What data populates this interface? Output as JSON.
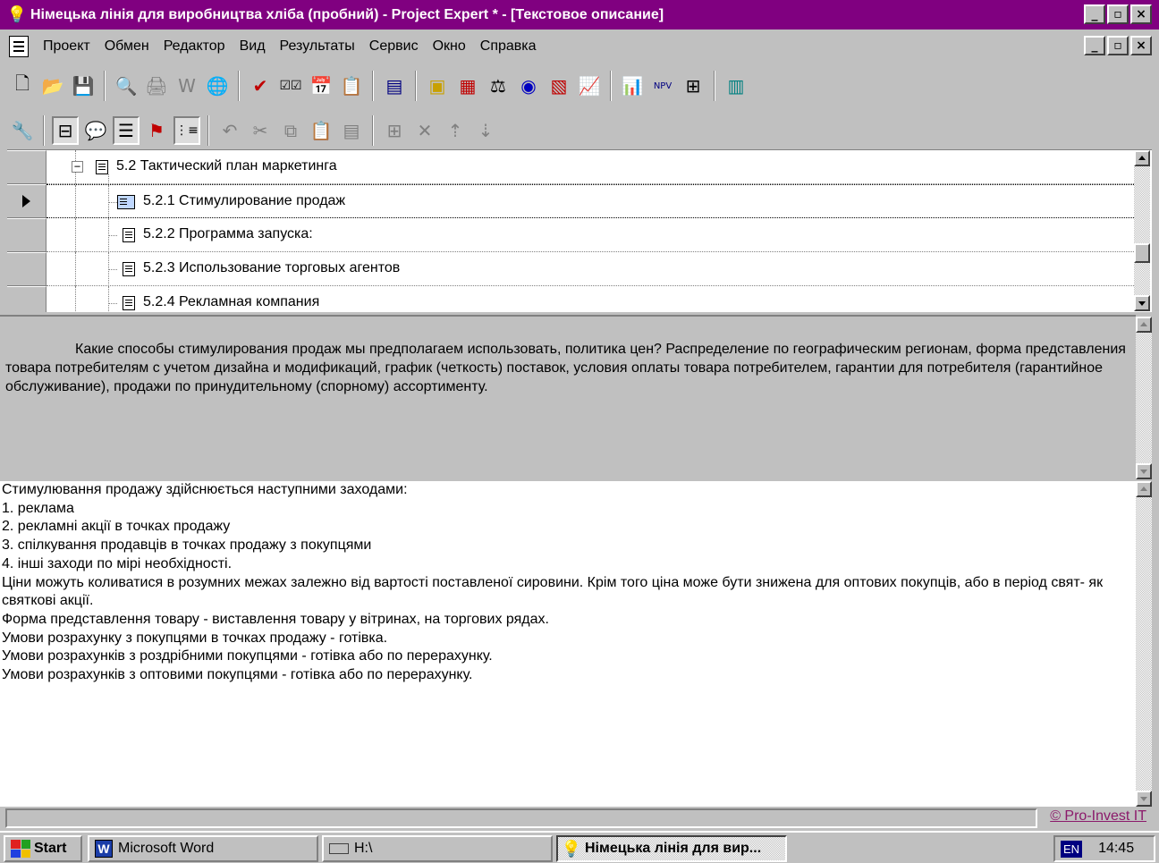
{
  "window": {
    "title": "Німецька лінія для виробництва хліба (пробний) - Project Expert * - [Текстовое описание]",
    "controls": {
      "minimize": "_",
      "restore": "▫",
      "close": "×"
    }
  },
  "menu": {
    "items": [
      "Проект",
      "Обмен",
      "Редактор",
      "Вид",
      "Результаты",
      "Сервис",
      "Окно",
      "Справка"
    ]
  },
  "toolbar1": {
    "icons": [
      "new-document-icon",
      "open-folder-icon",
      "save-disk-icon",
      "print-preview-icon",
      "print-icon",
      "word-export-icon",
      "globe-icon",
      "check-icon",
      "checklist-icon",
      "calendar-link-icon",
      "clipboard-icon",
      "window-icon",
      "table-icon",
      "chart-cf-icon",
      "balance-scale-icon",
      "analysis-icon",
      "report-icon",
      "graph-icon",
      "bar-chart-icon",
      "npv-icon",
      "network-icon",
      "calculator-icon"
    ]
  },
  "toolbar2": {
    "icons": [
      "wrench-icon",
      "tree-view-icon",
      "comment-icon",
      "list-view-icon",
      "stamp-icon",
      "numbering-icon",
      "undo-icon",
      "cut-icon",
      "copy-icon",
      "paste-icon",
      "format-icon",
      "move-node-icon",
      "delete-icon",
      "move-up-icon",
      "move-down-icon"
    ]
  },
  "tree": {
    "rows": [
      {
        "label": "5.2  Тактический план маркетинга",
        "level": 1,
        "expander": "−",
        "selected": false
      },
      {
        "label": "5.2.1 Стимулирование продаж",
        "level": 2,
        "selected": true
      },
      {
        "label": "5.2.2 Программа запуска:",
        "level": 2,
        "selected": false
      },
      {
        "label": "5.2.3 Использование торговых агентов",
        "level": 2,
        "selected": false
      },
      {
        "label": "5.2.4 Рекламная компания",
        "level": 2,
        "selected": false
      }
    ]
  },
  "description": {
    "text": "Какие способы стимулирования продаж мы предполагаем использовать, политика цен? Распределение по географическим регионам, форма представления товара потребителям с учетом дизайна и модификаций, график (четкость) поставок, условия оплаты товара потребителем, гарантии для потребителя (гарантийное обслуживание), продажи по принудительному (спорному) ассортименту."
  },
  "editor": {
    "lines": [
      "Стимулювання продажу здійснюється наступними заходами:",
      "1. реклама",
      "2. рекламні акції в точках продажу",
      "3. спілкування  продавців в точках продажу з покупцями",
      "4. інші заходи по мірі необхідності.",
      "Ціни можуть коливатися в розумних межах залежно від вартості поставленої сировини. Крім того ціна може бути знижена для оптових покупців, або в період свят- як святкові акції.",
      "Форма  представлення товару - виставлення товару у вітринах, на торгових рядах.",
      "Умови розрахунку з покупцями в точках продажу -  готівка.",
      "Умови розрахунків з роздрібними покупцями - готівка або по перерахунку.",
      "Умови розрахунків з оптовими покупцями - готівка або по перерахунку."
    ]
  },
  "statusbar": {
    "copyright": "© Pro-Invest IT"
  },
  "taskbar": {
    "start": "Start",
    "tasks": [
      {
        "label": "Microsoft Word",
        "icon": "word-icon",
        "active": false
      },
      {
        "label": "H:\\",
        "icon": "drive-icon",
        "active": false
      },
      {
        "label": "Німецька лінія для вир...",
        "icon": "bulb-icon",
        "active": true
      }
    ],
    "language": "EN",
    "clock": "14:45"
  }
}
